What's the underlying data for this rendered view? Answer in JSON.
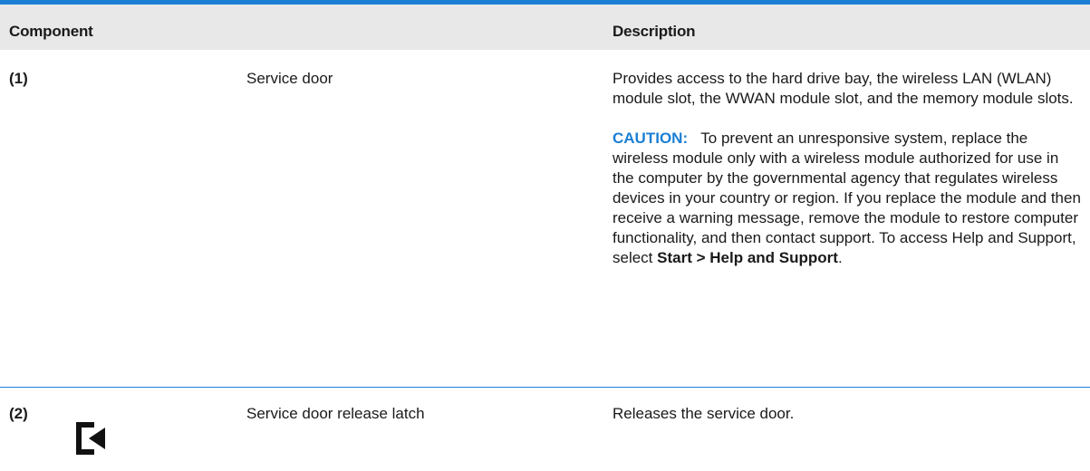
{
  "table": {
    "headers": {
      "component": "Component",
      "description": "Description"
    },
    "rows": [
      {
        "number": "(1)",
        "name": "Service door",
        "description_paragraph_1": "Provides access to the hard drive bay, the wireless LAN (WLAN) module slot, the WWAN module slot, and the memory module slots.",
        "caution_label": "CAUTION:",
        "caution_text": "To prevent an unresponsive system, replace the wireless module only with a wireless module authorized for use in the computer by the governmental agency that regulates wireless devices in your country or region. If you replace the module and then receive a warning message, remove the module to restore computer functionality, and then contact support. To access Help and Support, select",
        "caution_path": "Start > Help and Support",
        "caution_end": "."
      },
      {
        "number": "(2)",
        "icon": "service-door-release-latch-icon",
        "name": "Service door release latch",
        "description": "Releases the service door."
      }
    ]
  },
  "colors": {
    "accent": "#1b7fd4",
    "header_background": "#e8e8e8",
    "text": "#1a1a1a"
  }
}
